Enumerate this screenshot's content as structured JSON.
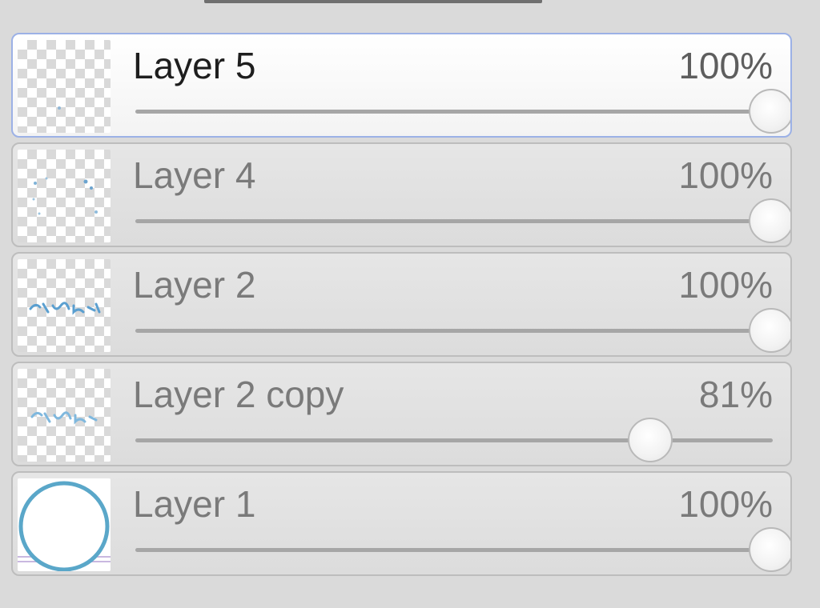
{
  "layers": [
    {
      "name": "Layer 5",
      "opacity_label": "100%",
      "opacity": 1.0,
      "selected": true
    },
    {
      "name": "Layer 4",
      "opacity_label": "100%",
      "opacity": 1.0,
      "selected": false
    },
    {
      "name": "Layer 2",
      "opacity_label": "100%",
      "opacity": 1.0,
      "selected": false
    },
    {
      "name": "Layer 2 copy",
      "opacity_label": "81%",
      "opacity": 0.81,
      "selected": false
    },
    {
      "name": "Layer 1",
      "opacity_label": "100%",
      "opacity": 1.0,
      "selected": false
    }
  ],
  "colors": {
    "panel_bg": "#dadada",
    "selected_border": "#9cb1e6",
    "row_border": "#bdbdbd",
    "slider_track": "#a6a6a6"
  }
}
